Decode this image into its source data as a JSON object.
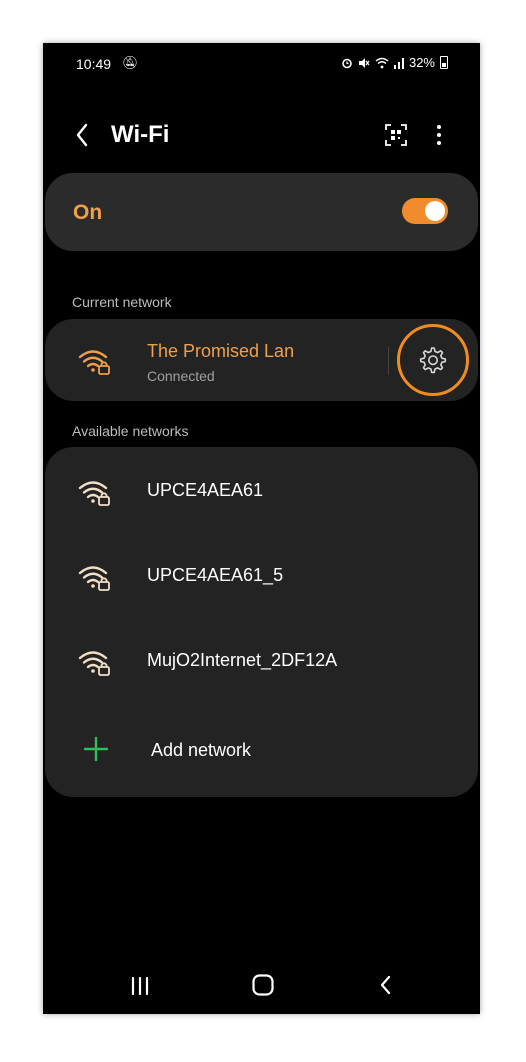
{
  "status_bar": {
    "time": "10:49",
    "battery": "32%",
    "icons": [
      "do-not-disturb-icon",
      "alarm-icon",
      "mute-icon",
      "wifi-icon",
      "signal-icon",
      "battery-icon"
    ]
  },
  "app_bar": {
    "title": "Wi-Fi",
    "back_icon": "back-arrow-icon",
    "qr_icon": "qr-scan-icon",
    "more_icon": "more-vert-icon"
  },
  "wifi_toggle": {
    "label": "On",
    "state": true
  },
  "current_network": {
    "section_label": "Current network",
    "name": "The Promised Lan",
    "status": "Connected",
    "icon": "wifi-lock-icon",
    "settings_icon": "gear-icon"
  },
  "available_networks": {
    "section_label": "Available networks",
    "items": [
      {
        "name": "UPCE4AEA61",
        "icon": "wifi-lock-icon"
      },
      {
        "name": "UPCE4AEA61_5",
        "icon": "wifi-lock-icon"
      },
      {
        "name": "MujO2Internet_2DF12A",
        "icon": "wifi-lock-icon"
      }
    ],
    "add_label": "Add network"
  },
  "nav_bar": {
    "recents_icon": "recents-icon",
    "home_icon": "home-icon",
    "back_icon": "back-icon"
  },
  "colors": {
    "accent": "#f08c2e",
    "accent_text": "#f0a04b",
    "card": "#232323",
    "toggle_card": "#2b2b2b",
    "add_plus": "#2fbf58",
    "highlight_ring": "#f08c1e"
  }
}
